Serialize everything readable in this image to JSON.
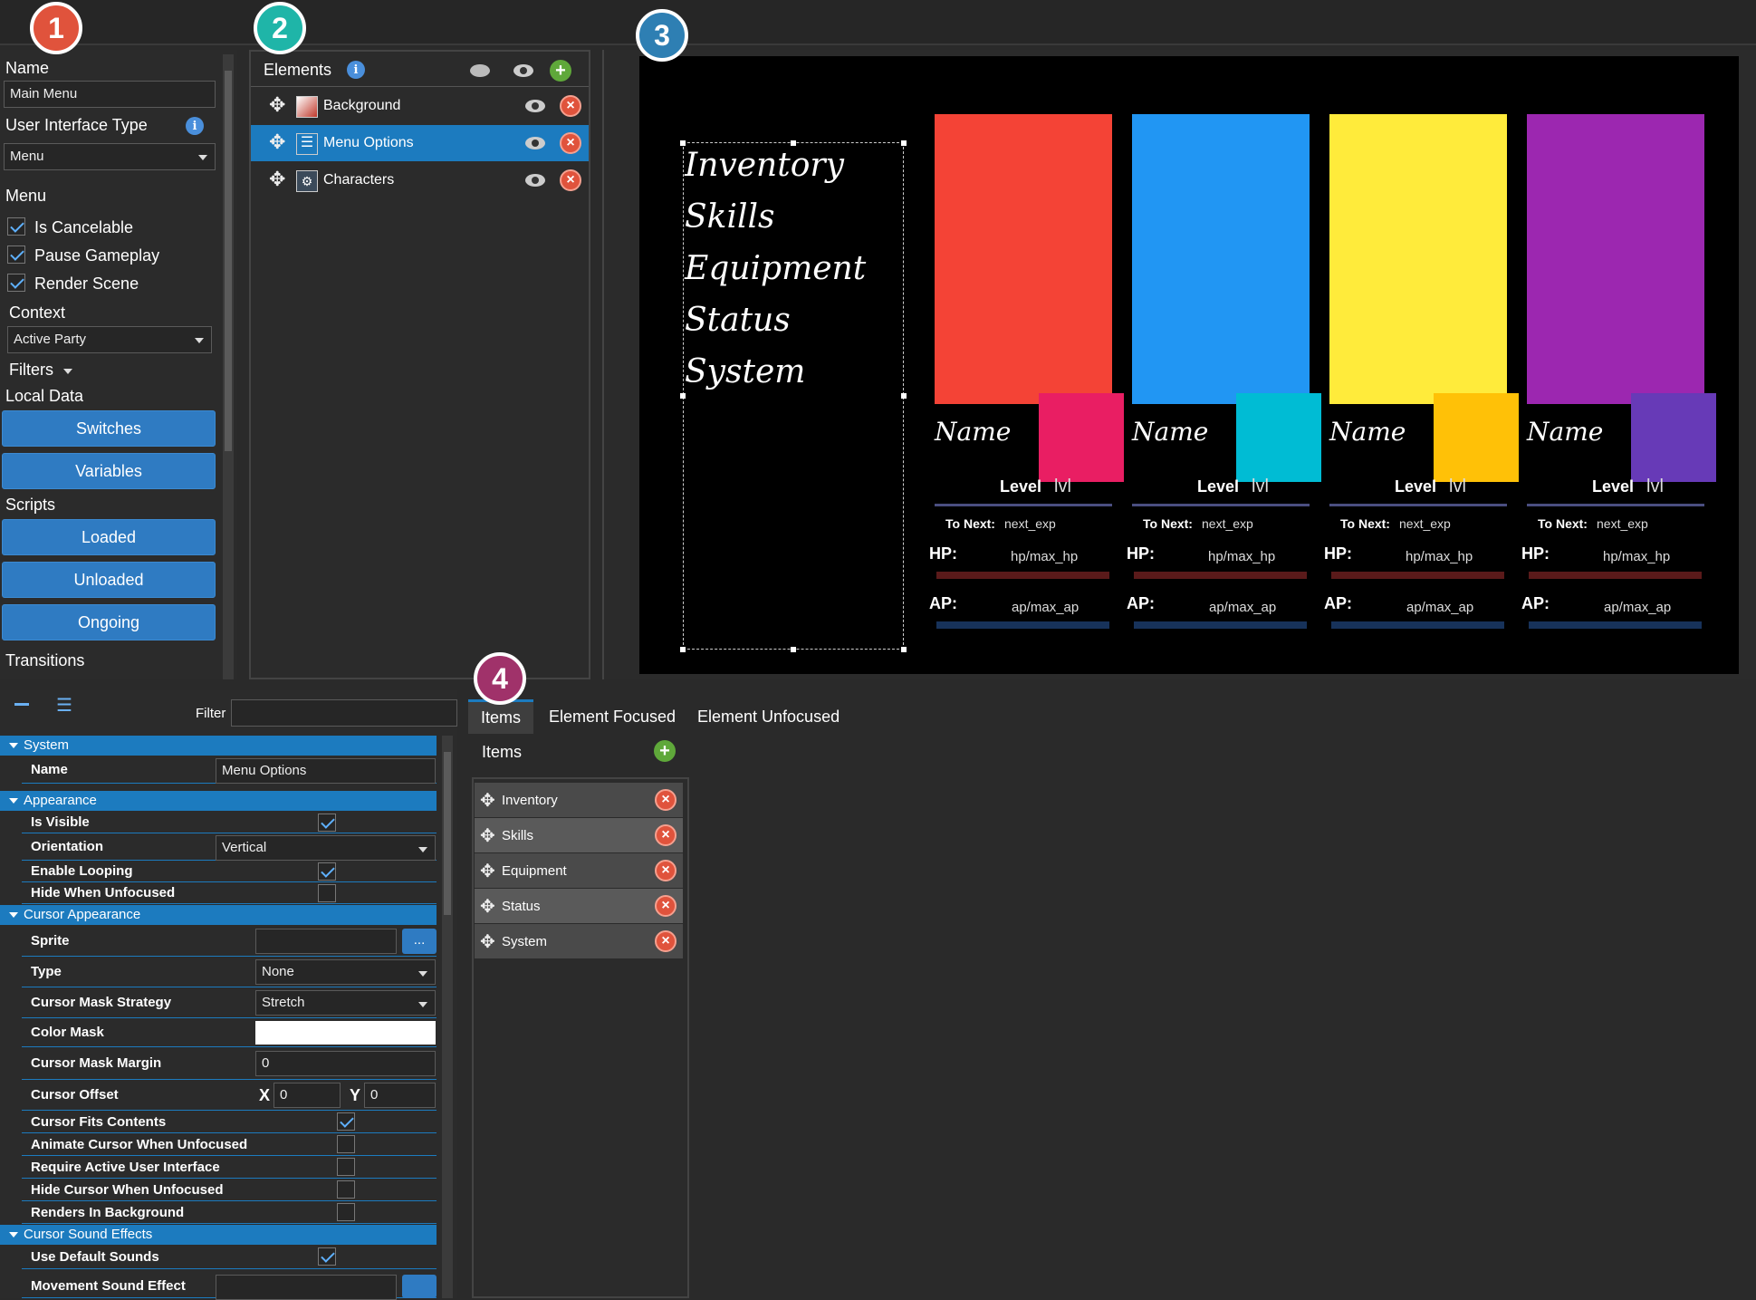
{
  "badges": [
    "1",
    "2",
    "3",
    "4"
  ],
  "left_panel": {
    "name_label": "Name",
    "name_value": "Main Menu",
    "ui_type_label": "User Interface Type",
    "ui_type_value": "Menu",
    "menu_label": "Menu",
    "is_cancelable": "Is Cancelable",
    "pause_gameplay": "Pause Gameplay",
    "render_scene": "Render Scene",
    "context_label": "Context",
    "context_value": "Active Party",
    "filters_label": "Filters",
    "local_data_label": "Local Data",
    "switches": "Switches",
    "variables": "Variables",
    "scripts_label": "Scripts",
    "loaded": "Loaded",
    "unloaded": "Unloaded",
    "ongoing": "Ongoing",
    "transitions_label": "Transitions"
  },
  "elements_panel": {
    "title": "Elements",
    "items": [
      "Background",
      "Menu Options",
      "Characters"
    ]
  },
  "preview": {
    "menu_items": [
      "Inventory",
      "Skills",
      "Equipment",
      "Status",
      "System"
    ],
    "card": {
      "name": "Name",
      "level_label": "Level",
      "level_value": "lvl",
      "to_next_label": "To Next:",
      "to_next_value": "next_exp",
      "hp_label": "HP:",
      "hp_value": "hp/max_hp",
      "ap_label": "AP:",
      "ap_value": "ap/max_ap"
    },
    "colors": {
      "card1": "#f44336",
      "accent1": "#e91e63",
      "card2": "#2196f3",
      "accent2": "#00bcd4",
      "card3": "#ffeb3b",
      "accent3": "#ffc107",
      "card4": "#9c27b0",
      "accent4": "#673ab7"
    }
  },
  "properties": {
    "filter_label": "Filter",
    "system": "System",
    "name_label": "Name",
    "name_value": "Menu Options",
    "appearance": "Appearance",
    "is_visible": "Is Visible",
    "orientation": "Orientation",
    "orientation_value": "Vertical",
    "enable_looping": "Enable Looping",
    "hide_when_unfocused": "Hide When Unfocused",
    "cursor_appearance": "Cursor Appearance",
    "sprite": "Sprite",
    "sprite_btn": "...",
    "type": "Type",
    "type_value": "None",
    "mask_strategy": "Cursor Mask Strategy",
    "mask_strategy_value": "Stretch",
    "color_mask": "Color Mask",
    "mask_margin": "Cursor Mask Margin",
    "mask_margin_value": "0",
    "cursor_offset": "Cursor Offset",
    "x_label": "X",
    "x_value": "0",
    "y_label": "Y",
    "y_value": "0",
    "fits_contents": "Cursor Fits Contents",
    "animate_unfocused": "Animate Cursor When Unfocused",
    "require_active": "Require Active User Interface",
    "hide_cursor": "Hide Cursor When Unfocused",
    "renders_bg": "Renders In Background",
    "sound_effects": "Cursor Sound Effects",
    "default_sounds": "Use Default Sounds",
    "movement_sound": "Movement Sound Effect"
  },
  "tabs": [
    "Items",
    "Element Focused",
    "Element Unfocused"
  ],
  "items_panel": {
    "title": "Items",
    "items": [
      "Inventory",
      "Skills",
      "Equipment",
      "Status",
      "System"
    ]
  }
}
